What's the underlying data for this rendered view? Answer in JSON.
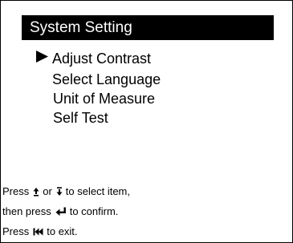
{
  "title": "System Setting",
  "menu": {
    "selected_index": 0,
    "items": [
      {
        "label": "Adjust Contrast"
      },
      {
        "label": "Select Language"
      },
      {
        "label": "Unit of Measure"
      },
      {
        "label": "Self Test"
      }
    ]
  },
  "help": {
    "line1": {
      "prefix": "Press",
      "up_icon": "arrow-up-icon",
      "middle": "or",
      "down_icon": "arrow-down-icon",
      "suffix": "to select item,"
    },
    "line2": {
      "prefix": "then press",
      "enter_icon": "enter-icon",
      "suffix": "to confirm."
    },
    "line3": {
      "prefix": "Press",
      "back_icon": "rewind-icon",
      "suffix": "to exit."
    }
  }
}
